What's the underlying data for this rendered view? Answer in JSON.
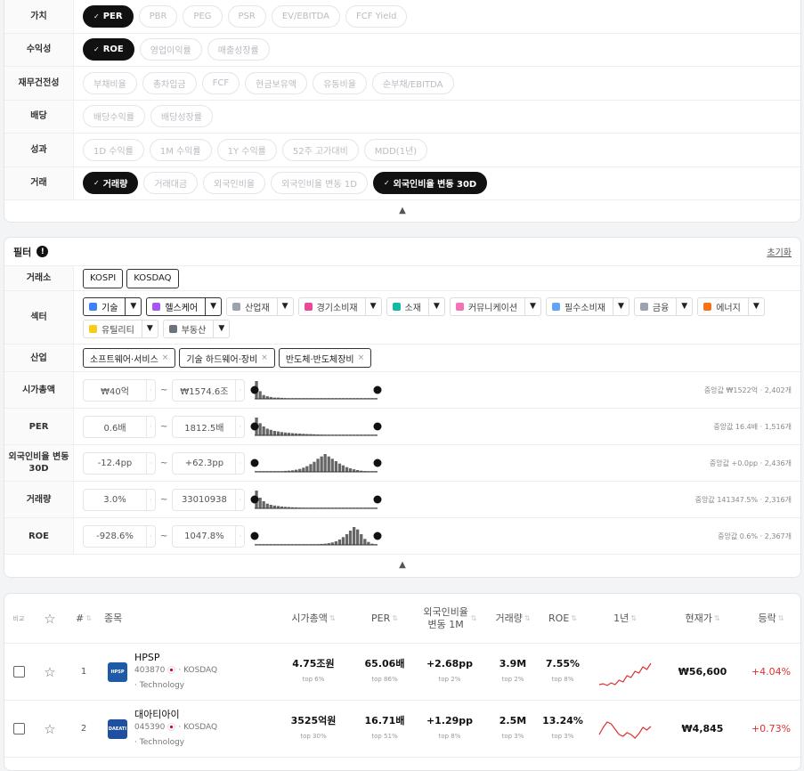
{
  "metrics": [
    {
      "label": "가치",
      "chips": [
        {
          "t": "PER",
          "on": true
        },
        {
          "t": "PBR"
        },
        {
          "t": "PEG"
        },
        {
          "t": "PSR"
        },
        {
          "t": "EV/EBITDA"
        },
        {
          "t": "FCF Yield"
        }
      ]
    },
    {
      "label": "수익성",
      "chips": [
        {
          "t": "ROE",
          "on": true
        },
        {
          "t": "영업이익률"
        },
        {
          "t": "매출성장률"
        }
      ]
    },
    {
      "label": "재무건전성",
      "chips": [
        {
          "t": "부채비율"
        },
        {
          "t": "총차입금"
        },
        {
          "t": "FCF"
        },
        {
          "t": "현금보유액"
        },
        {
          "t": "유동비율"
        },
        {
          "t": "순부채/EBITDA"
        }
      ]
    },
    {
      "label": "배당",
      "chips": [
        {
          "t": "배당수익률"
        },
        {
          "t": "배당성장률"
        }
      ]
    },
    {
      "label": "성과",
      "chips": [
        {
          "t": "1D 수익률"
        },
        {
          "t": "1M 수익률"
        },
        {
          "t": "1Y 수익률"
        },
        {
          "t": "52주 고가대비"
        },
        {
          "t": "MDD(1년)"
        }
      ]
    },
    {
      "label": "거래",
      "chips": [
        {
          "t": "거래량",
          "on": true
        },
        {
          "t": "거래대금"
        },
        {
          "t": "외국인비율"
        },
        {
          "t": "외국인비율 변동 1D"
        },
        {
          "t": "외국인비율 변동 30D",
          "on": true
        }
      ]
    }
  ],
  "collapse_glyph": "▲",
  "filter": {
    "title": "필터",
    "info": "!",
    "reset": "초기화",
    "exchange": {
      "label": "거래소",
      "items": [
        "KOSPI",
        "KOSDAQ"
      ]
    },
    "sector": {
      "label": "섹터",
      "dd": "▼",
      "items": [
        {
          "t": "기술",
          "on": true,
          "c": "#3b82f6"
        },
        {
          "t": "헬스케어",
          "on": true,
          "c": "#a855f7"
        },
        {
          "t": "산업재",
          "c": "#9ca3af"
        },
        {
          "t": "경기소비재",
          "c": "#ec4899"
        },
        {
          "t": "소재",
          "c": "#14b8a6"
        },
        {
          "t": "커뮤니케이션",
          "c": "#f472b6"
        },
        {
          "t": "필수소비재",
          "c": "#60a5fa"
        },
        {
          "t": "금융",
          "c": "#9ca3af"
        },
        {
          "t": "에너지",
          "c": "#f97316"
        },
        {
          "t": "유틸리티",
          "c": "#facc15"
        },
        {
          "t": "부동산",
          "c": "#6b7280"
        }
      ]
    },
    "industry": {
      "label": "산업",
      "x": "×",
      "items": [
        "소프트웨어·서비스",
        "기술 하드웨어·장비",
        "반도체·반도체장비"
      ]
    },
    "ranges": [
      {
        "label": "시가총액",
        "min": "₩40억",
        "max": "₩1574.6조",
        "median": "중앙값 ₩1522억 · 2,402개",
        "hist": [
          14,
          6,
          3,
          2,
          1.5,
          1,
          1,
          0.8,
          0.6,
          0.5,
          0.4,
          0.3,
          0.3,
          0.2,
          0.2,
          0.2,
          0.1,
          0.1,
          0.1,
          0.1,
          0.1,
          0.1,
          0.1,
          0.1,
          0.1,
          0.1,
          0.1,
          0.1,
          0.1,
          0.1,
          0.1,
          0.1,
          0.1,
          0.1
        ]
      },
      {
        "label": "PER",
        "min": "0.6배",
        "max": "1812.5배",
        "median": "중앙값 16.4배 · 1,516개",
        "hist": [
          16,
          11,
          8,
          6,
          5,
          4,
          3.5,
          3,
          2.6,
          2.3,
          2,
          1.8,
          1.6,
          1.4,
          1.2,
          1.1,
          1,
          0.8,
          0.7,
          0.6,
          0.5,
          0.5,
          0.4,
          0.4,
          0.3,
          0.3,
          0.2,
          0.2,
          0.2,
          0.2,
          0.1,
          0.1,
          0.1,
          0.1
        ]
      },
      {
        "label": "외국인비율 변동 30D",
        "min": "-12.4pp",
        "max": "+62.3pp",
        "median": "중앙값 +0.0pp · 2,436개",
        "hist": [
          0.2,
          0.2,
          0.2,
          0.3,
          0.3,
          0.4,
          0.5,
          0.6,
          0.8,
          1,
          1.3,
          1.8,
          2.5,
          3.5,
          4.8,
          6.5,
          8.5,
          11,
          13,
          15,
          13,
          11,
          9,
          7,
          5.5,
          4,
          3,
          2.2,
          1.5,
          1,
          0.7,
          0.4,
          0.3,
          0.2
        ]
      },
      {
        "label": "거래량",
        "min": "3.0%",
        "max": "33010938",
        "median": "중앙값 141347.5% · 2,316개",
        "hist": [
          15,
          9,
          6,
          4,
          3,
          2.4,
          2,
          1.6,
          1.3,
          1.1,
          0.9,
          0.8,
          0.7,
          0.6,
          0.5,
          0.4,
          0.4,
          0.3,
          0.3,
          0.2,
          0.2,
          0.2,
          0.2,
          0.1,
          0.1,
          0.1,
          0.1,
          0.1,
          0.1,
          0.1,
          0.1,
          0.1,
          0.1,
          0.1
        ]
      },
      {
        "label": "ROE",
        "min": "-928.6%",
        "max": "1047.8%",
        "median": "중앙값 0.6% · 2,367개",
        "hist": [
          0.1,
          0.1,
          0.1,
          0.1,
          0.1,
          0.1,
          0.1,
          0.1,
          0.1,
          0.1,
          0.1,
          0.1,
          0.2,
          0.2,
          0.3,
          0.4,
          0.5,
          0.6,
          0.8,
          1,
          1.4,
          2,
          3,
          4.5,
          6.5,
          9,
          12,
          15,
          13,
          9,
          5,
          2.5,
          1,
          0.3
        ]
      }
    ]
  },
  "table": {
    "headers": {
      "compare": "비교",
      "star": "☆",
      "num": "#",
      "name": "종목",
      "mcap": "시가총액",
      "per": "PER",
      "fx": "외국인비율 변동 1M",
      "vol": "거래량",
      "roe": "ROE",
      "yr": "1년",
      "price": "현재가",
      "chg": "등락",
      "sort": "⇅"
    },
    "rows": [
      {
        "n": "1",
        "name": "HPSP",
        "code": "403870",
        "ex": "· KOSDAQ",
        "sector": "· Technology",
        "logo": "HPSP",
        "logo_bg": "#1e5aa8",
        "mcap": "4.75조원",
        "mcap_t": "top 6%",
        "per": "65.06배",
        "per_t": "top 86%",
        "fx": "+2.68pp",
        "fx_t": "top 2%",
        "vol": "3.9M",
        "vol_t": "top 2%",
        "roe": "7.55%",
        "roe_t": "top 8%",
        "spark": [
          30,
          29,
          31,
          28,
          30,
          25,
          27,
          20,
          22,
          15,
          17,
          10,
          13,
          6
        ],
        "price": "₩56,600",
        "chg": "+4.04%"
      },
      {
        "n": "2",
        "name": "대아티아이",
        "code": "045390",
        "ex": "· KOSDAQ",
        "sector": "· Technology",
        "logo": "DAEATI",
        "logo_bg": "#1e4fa0",
        "mcap": "3525억원",
        "mcap_t": "top 30%",
        "per": "16.71배",
        "per_t": "top 51%",
        "fx": "+1.29pp",
        "fx_t": "top 8%",
        "vol": "2.5M",
        "vol_t": "top 3%",
        "roe": "13.24%",
        "roe_t": "top 3%",
        "spark": [
          22,
          14,
          8,
          10,
          16,
          22,
          24,
          20,
          22,
          26,
          21,
          14,
          17,
          13
        ],
        "price": "₩4,845",
        "chg": "+0.73%"
      }
    ]
  }
}
